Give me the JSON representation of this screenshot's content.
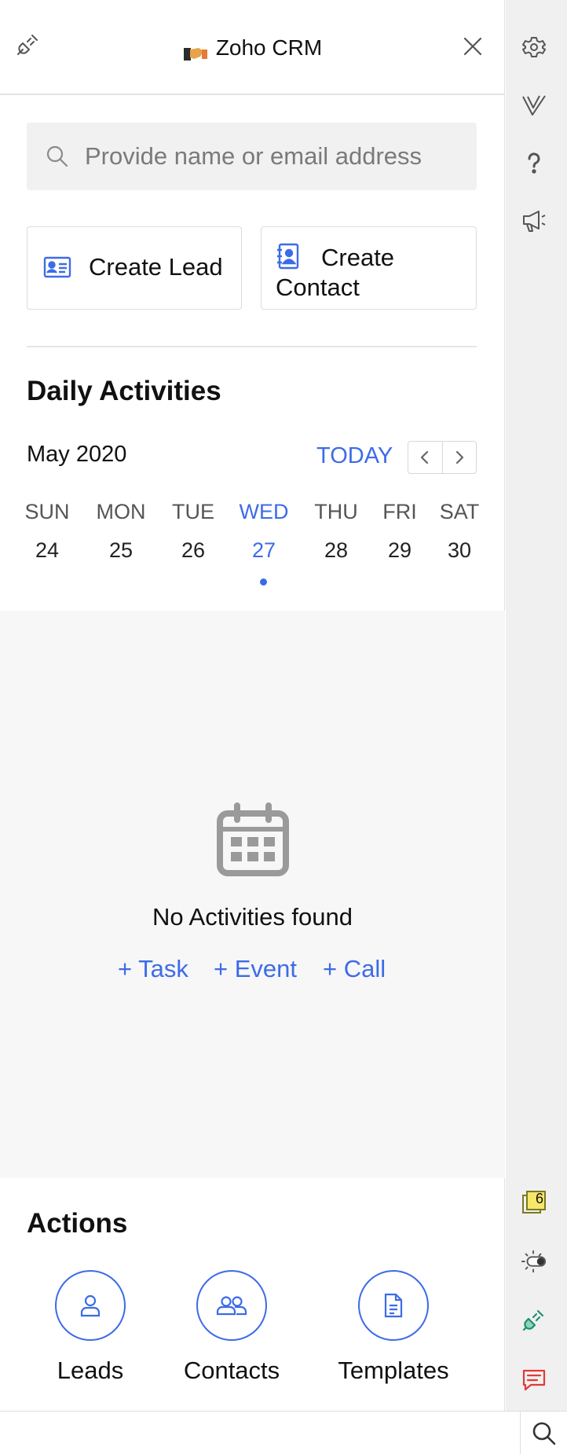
{
  "header": {
    "title": "Zoho CRM"
  },
  "search": {
    "placeholder": "Provide name or email address"
  },
  "create": {
    "lead_label": "Create Lead",
    "contact_label": "Create Contact"
  },
  "daily": {
    "heading": "Daily Activities",
    "month": "May 2020",
    "today_label": "TODAY",
    "days": [
      {
        "name": "SUN",
        "date": "24"
      },
      {
        "name": "MON",
        "date": "25"
      },
      {
        "name": "TUE",
        "date": "26"
      },
      {
        "name": "WED",
        "date": "27"
      },
      {
        "name": "THU",
        "date": "28"
      },
      {
        "name": "FRI",
        "date": "29"
      },
      {
        "name": "SAT",
        "date": "30"
      }
    ],
    "selected_index": 3
  },
  "empty": {
    "message": "No Activities found",
    "task": "+ Task",
    "event": "+ Event",
    "call": "+ Call"
  },
  "actions": {
    "heading": "Actions",
    "items": [
      {
        "label": "Leads",
        "icon": "person-icon"
      },
      {
        "label": "Contacts",
        "icon": "people-icon"
      },
      {
        "label": "Templates",
        "icon": "document-icon"
      }
    ]
  },
  "rail": {
    "badge_count": "6"
  },
  "colors": {
    "accent": "#3d6be8",
    "empty_bg": "#f7f7f7",
    "rail_bg": "#f0f0f0"
  }
}
